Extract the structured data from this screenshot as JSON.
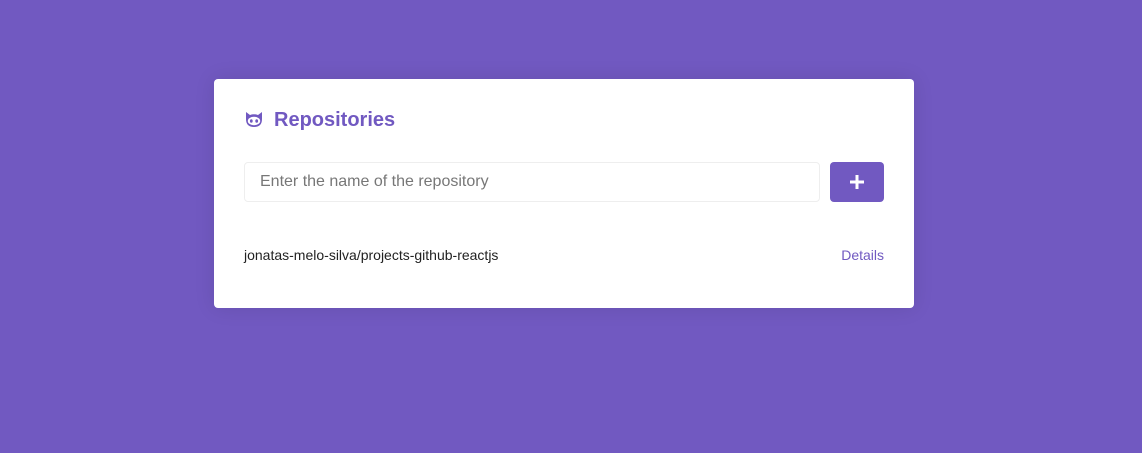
{
  "header": {
    "title": "Repositories",
    "icon": "github-octocat-icon"
  },
  "form": {
    "placeholder": "Enter the name of the repository",
    "value": "",
    "add_button_icon": "plus-icon"
  },
  "repositories": [
    {
      "name": "jonatas-melo-silva/projects-github-reactjs",
      "link_label": "Details"
    }
  ],
  "colors": {
    "background": "#7159c1",
    "accent": "#7159c1",
    "card": "#ffffff"
  }
}
